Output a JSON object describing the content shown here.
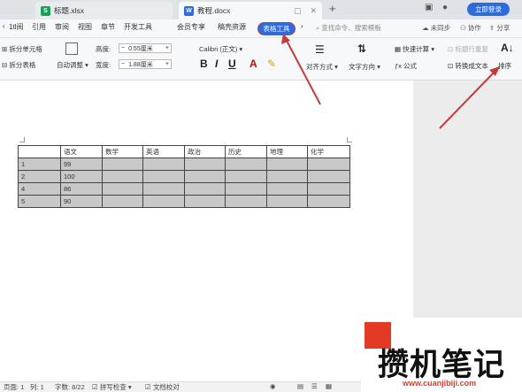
{
  "tabs": [
    {
      "label": "标题.xlsx",
      "icon": "S",
      "active": false
    },
    {
      "label": "教程.docx",
      "icon": "W",
      "active": true
    }
  ],
  "login_button": "立即登录",
  "menu": [
    "引用",
    "审阅",
    "视图",
    "章节",
    "开发工具",
    "会员专享",
    "稿壳资源"
  ],
  "menu_left_partial": "审阅",
  "active_tool": "表格工具",
  "search_placeholder": "查找命令、搜索模板",
  "top_right": {
    "sync": "未同步",
    "collab": "协作",
    "share": "分享"
  },
  "ribbon": {
    "split_cells": "拆分单元格",
    "split_table": "拆分表格",
    "autofit": "自动调整",
    "height_label": "高度:",
    "height_value": "0.55厘米",
    "width_label": "宽度:",
    "width_value": "1.88厘米",
    "font_name": "Calibri (正文)",
    "align": "对齐方式",
    "text_direction": "文字方向",
    "quick_calc": "快速计算",
    "formula": "公式",
    "title_repeat": "标题行重复",
    "convert_text": "转换成文本",
    "sort": "排序"
  },
  "table": {
    "headers": [
      "",
      "语文",
      "数学",
      "英语",
      "政治",
      "历史",
      "地理",
      "化学"
    ],
    "rows": [
      [
        "1",
        "99",
        "",
        "",
        "",
        "",
        "",
        ""
      ],
      [
        "2",
        "100",
        "",
        "",
        "",
        "",
        "",
        ""
      ],
      [
        "4",
        "86",
        "",
        "",
        "",
        "",
        "",
        ""
      ],
      [
        "5",
        "90",
        "",
        "",
        "",
        "",
        "",
        ""
      ]
    ]
  },
  "status": {
    "page": "页面: 1",
    "col": "列: 1",
    "words": "字数: 8/22",
    "spell": "拼写检查",
    "proof": "文档校对"
  },
  "watermark": {
    "text": "攒机笔记",
    "url": "www.cuanjibiji.com"
  },
  "colors": {
    "accent": "#2f6bd9",
    "arrow": "#c43b3b",
    "selected_row": "#c8c8c8",
    "watermark_red": "#e23a25"
  }
}
